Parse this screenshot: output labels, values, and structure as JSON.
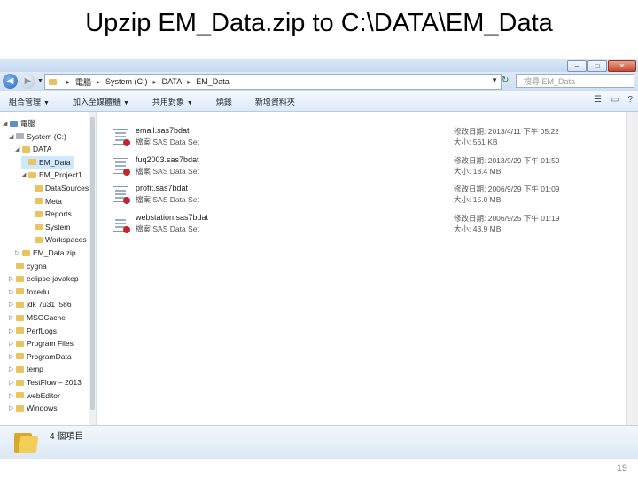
{
  "slide": {
    "title": "Upzip EM_Data.zip to C:\\DATA\\EM_Data",
    "page_number": "19"
  },
  "window": {
    "buttons": [
      "–",
      "□",
      "✕"
    ]
  },
  "address_bar": {
    "crumbs": [
      "電腦",
      "System (C:)",
      "DATA",
      "EM_Data"
    ],
    "search_placeholder": "搜尋 EM_Data"
  },
  "toolbar": {
    "items": [
      "組合管理",
      "加入至媒體櫃",
      "共用對象",
      "燒錄",
      "新增資料夾"
    ]
  },
  "tree": [
    {
      "label": "電腦",
      "indent": 1,
      "icon": "computer-icon",
      "expander": "◢"
    },
    {
      "label": "System (C:)",
      "indent": 2,
      "icon": "drive-icon",
      "expander": "◢"
    },
    {
      "label": "DATA",
      "indent": 3,
      "icon": "folder-icon",
      "expander": "◢"
    },
    {
      "label": "EM_Data",
      "indent": 4,
      "icon": "folder-icon",
      "expander": "",
      "selected": true
    },
    {
      "label": "EM_Project1",
      "indent": 4,
      "icon": "folder-icon",
      "expander": "◢"
    },
    {
      "label": "DataSources",
      "indent": 5,
      "icon": "folder-icon",
      "expander": ""
    },
    {
      "label": "Meta",
      "indent": 5,
      "icon": "folder-icon",
      "expander": ""
    },
    {
      "label": "Reports",
      "indent": 5,
      "icon": "folder-icon",
      "expander": ""
    },
    {
      "label": "System",
      "indent": 5,
      "icon": "folder-icon",
      "expander": ""
    },
    {
      "label": "Workspaces",
      "indent": 5,
      "icon": "folder-icon",
      "expander": ""
    },
    {
      "label": "EM_Data.zip",
      "indent": 3,
      "icon": "folder-icon",
      "expander": "▷"
    },
    {
      "label": "cygna",
      "indent": 2,
      "icon": "folder-icon",
      "expander": ""
    },
    {
      "label": "eclipse-javakep",
      "indent": 2,
      "icon": "folder-icon",
      "expander": "▷"
    },
    {
      "label": "foxedu",
      "indent": 2,
      "icon": "folder-icon",
      "expander": "▷"
    },
    {
      "label": "jdk 7u31 i586",
      "indent": 2,
      "icon": "folder-icon",
      "expander": "▷"
    },
    {
      "label": "MSOCache",
      "indent": 2,
      "icon": "folder-icon",
      "expander": "▷"
    },
    {
      "label": "PerfLogs",
      "indent": 2,
      "icon": "folder-icon",
      "expander": "▷"
    },
    {
      "label": "Program Files",
      "indent": 2,
      "icon": "folder-icon",
      "expander": "▷"
    },
    {
      "label": "ProgramData",
      "indent": 2,
      "icon": "folder-icon",
      "expander": "▷"
    },
    {
      "label": "temp",
      "indent": 2,
      "icon": "folder-icon",
      "expander": "▷"
    },
    {
      "label": "TestFlow – 2013",
      "indent": 2,
      "icon": "folder-icon",
      "expander": "▷"
    },
    {
      "label": "webEditor",
      "indent": 2,
      "icon": "folder-icon",
      "expander": "▷"
    },
    {
      "label": "Windows",
      "indent": 2,
      "icon": "folder-icon",
      "expander": "▷"
    }
  ],
  "files": [
    {
      "name": "email.sas7bdat",
      "type": "檔案 SAS Data Set",
      "date": "修改日期: 2013/4/11 下午 05:22",
      "size": "大小: 561 KB"
    },
    {
      "name": "fuq2003.sas7bdat",
      "type": "檔案 SAS Data Set",
      "date": "修改日期: 2013/9/29 下午 01:50",
      "size": "大小: 18.4 MB"
    },
    {
      "name": "profit.sas7bdat",
      "type": "檔案 SAS Data Set",
      "date": "修改日期: 2006/9/29 下午 01:09",
      "size": "大小: 15.0 MB"
    },
    {
      "name": "webstation.sas7bdat",
      "type": "檔案 SAS Data Set",
      "date": "修改日期: 2006/9/25 下午 01:19",
      "size": "大小: 43.9 MB"
    }
  ],
  "details": {
    "count": "4 個項目"
  },
  "colors": {
    "selection": "#cde8ff",
    "titlebar": "#c5d9f0",
    "folder": "#eac45e",
    "sas_dot": "#c0262b"
  }
}
